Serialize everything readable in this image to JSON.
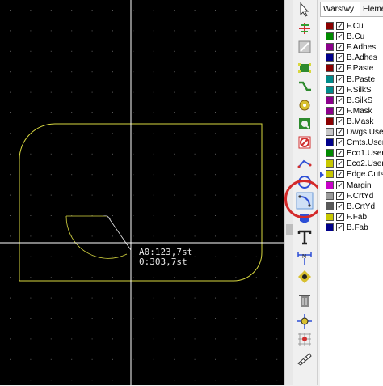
{
  "canvas": {
    "background": "#000000",
    "board_outline_color": "#d8d840",
    "cursor_color": "#ffffff",
    "grid": true,
    "readout_line1": "A0:123,7st",
    "readout_line2": "0:303,7st"
  },
  "toolbar": {
    "tools": [
      {
        "name": "select-arrow-icon"
      },
      {
        "name": "highlight-net-icon"
      },
      {
        "name": "local-ratsnest-icon"
      },
      {
        "name": "add-footprint-icon"
      },
      {
        "name": "route-track-icon"
      },
      {
        "name": "add-via-icon"
      },
      {
        "name": "add-zone-icon"
      },
      {
        "name": "keepout-area-icon"
      },
      {
        "name": "add-line-icon"
      },
      {
        "name": "add-circle-icon"
      },
      {
        "name": "add-arc-icon"
      },
      {
        "name": "add-polygon-icon"
      },
      {
        "name": "add-text-icon"
      },
      {
        "name": "add-dimension-icon"
      },
      {
        "name": "add-target-icon"
      },
      {
        "name": "delete-icon"
      },
      {
        "name": "set-origin-icon"
      },
      {
        "name": "grid-origin-icon"
      },
      {
        "name": "measure-icon"
      }
    ],
    "active_tool": "add-arc-icon"
  },
  "panel": {
    "tabs": [
      "Warstwy",
      "Elemen"
    ],
    "active_layer": "Edge.Cuts",
    "layers": [
      {
        "name": "F.Cu",
        "color": "#8b0000",
        "checked": true
      },
      {
        "name": "B.Cu",
        "color": "#008b00",
        "checked": true
      },
      {
        "name": "F.Adhes",
        "color": "#8b008b",
        "checked": true
      },
      {
        "name": "B.Adhes",
        "color": "#00008b",
        "checked": true
      },
      {
        "name": "F.Paste",
        "color": "#8b0000",
        "checked": true
      },
      {
        "name": "B.Paste",
        "color": "#008b8b",
        "checked": true
      },
      {
        "name": "F.SilkS",
        "color": "#008b8b",
        "checked": true
      },
      {
        "name": "B.SilkS",
        "color": "#8b008b",
        "checked": true
      },
      {
        "name": "F.Mask",
        "color": "#8b008b",
        "checked": true
      },
      {
        "name": "B.Mask",
        "color": "#8b0000",
        "checked": true
      },
      {
        "name": "Dwgs.User",
        "color": "#c8c8c8",
        "checked": true
      },
      {
        "name": "Cmts.User",
        "color": "#00008b",
        "checked": true
      },
      {
        "name": "Eco1.User",
        "color": "#008b00",
        "checked": true
      },
      {
        "name": "Eco2.User",
        "color": "#c8c800",
        "checked": true
      },
      {
        "name": "Edge.Cuts",
        "color": "#c8c800",
        "checked": true
      },
      {
        "name": "Margin",
        "color": "#c800c8",
        "checked": true
      },
      {
        "name": "F.CrtYd",
        "color": "#9a9a9a",
        "checked": true
      },
      {
        "name": "B.CrtYd",
        "color": "#5a5a5a",
        "checked": true
      },
      {
        "name": "F.Fab",
        "color": "#c8c800",
        "checked": true
      },
      {
        "name": "B.Fab",
        "color": "#00008b",
        "checked": true
      }
    ]
  }
}
